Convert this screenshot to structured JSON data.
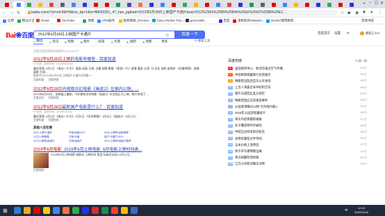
{
  "browser": {
    "tabs": [
      {
        "color": "#e10601"
      },
      {
        "color": "#4285f4"
      },
      {
        "color": "#34a853"
      },
      {
        "color": "#fbbc05"
      },
      {
        "color": "#ea4335"
      },
      {
        "color": "#5f6368"
      },
      {
        "color": "#4285f4"
      },
      {
        "color": "#2932e1"
      },
      {
        "color": "#e10601"
      },
      {
        "color": "#e10601"
      },
      {
        "color": "#0f9d58"
      },
      {
        "color": "#673ab7"
      },
      {
        "color": "#ff7043"
      },
      {
        "color": "#2932e1"
      },
      {
        "color": "#4285f4"
      },
      {
        "color": "#e10601"
      },
      {
        "color": "#34a853"
      },
      {
        "color": "#f4b400"
      },
      {
        "color": "#e10601"
      },
      {
        "color": "#4285f4"
      },
      {
        "color": "#ea4335"
      },
      {
        "color": "#2932e1"
      },
      {
        "color": "#0f9d58"
      },
      {
        "color": "#5f6368"
      },
      {
        "color": "#e10601"
      },
      {
        "color": "#4285f4"
      },
      {
        "color": "#fbbc05"
      },
      {
        "color": "#e10601"
      },
      {
        "color": "#2932e1"
      },
      {
        "color": "#34a853"
      },
      {
        "color": "#e10601"
      },
      {
        "color": "#2932e1"
      }
    ],
    "new_tab": "+",
    "url": "baidu.com/s?ie=utf-8&f=8&rsv_bp=1&tn=88093251_47_hao_pg&wd=2012年6月28日上映国产卡通片&oq=2012%25E5%25B9%25B46%25E6%259C%2588%25E2...",
    "bookmarks": [
      {
        "label": "应用",
        "color": "#4285f4"
      },
      {
        "label": "网址大全",
        "color": "#34a853"
      },
      {
        "label": "Gmail",
        "color": "#ea4335"
      },
      {
        "label": "YouTube",
        "color": "#ff0000"
      },
      {
        "label": "地图",
        "color": "#34a853"
      },
      {
        "label": "VPN服务",
        "color": "#4285f4"
      },
      {
        "label": "极客搜搜_Chrome...",
        "color": "#fbbc05"
      },
      {
        "label": "Cisco Packet Trac...",
        "color": "#1ba0d7"
      },
      {
        "label": "gnmxxl/all...",
        "color": "#333333"
      },
      {
        "label": "百度",
        "color": "#2932e1"
      },
      {
        "label": "虚拟机的VMware...",
        "color": "#e10601"
      },
      {
        "label": "Docker使用教程...",
        "color": "#2496ed"
      }
    ],
    "bookmarks_more": "其他书签"
  },
  "header": {
    "query": "2012年6月28日上映国产卡通片",
    "search_button": "百度一下",
    "right_links": [
      "百度首页",
      "设置"
    ],
    "username": "最爱正义00"
  },
  "search_tabs": [
    {
      "label": "网页",
      "icon": "◎"
    },
    {
      "label": "资讯",
      "icon": "▤"
    },
    {
      "label": "视频",
      "icon": "▶"
    },
    {
      "label": "图片",
      "icon": "▣"
    },
    {
      "label": "知道",
      "icon": "?"
    },
    {
      "label": "文库",
      "icon": "▥"
    },
    {
      "label": "贴吧",
      "icon": "◧"
    },
    {
      "label": "地图",
      "icon": "◉"
    },
    {
      "label": "更多",
      "icon": "⋯"
    }
  ],
  "search_tools": "搜索工具",
  "result_count": "百度为您找到相关结果约9,510,000个",
  "results": [
    {
      "title_pre": "2012年6月28日上映",
      "title_post": "的电影有哪些 - 百度知道",
      "meta": "1个回答 - 回答时间：2012年6月28日",
      "abstract": "最佳答案: 6月1日 《青出一片天》 喜剧 动画 主演: 白蕾 胡静 黄璐 《家庭一片》爱情 喜剧 主演: 冯 远征 张熙 梁锦祥 《旧情绵绵》 爱情 喜剧 主演...",
      "url": "更多关于2012年6月28日上映国产卡通片的问题>>",
      "foot": [
        "百度知道",
        "百度快照"
      ]
    },
    {
      "title_pre": "2012年6月28日",
      "title_post": "内地观众幻电影《画皮2》在国内公映。...",
      "meta": "",
      "abstract": "2012年6月28日，由陈嘉上编剧、乌尔善执导的电影《画皮2》在全国正式上映。影片讲述了...",
      "url": "",
      "foot": [
        "百度百科",
        "百度快照"
      ]
    },
    {
      "title_pre": "2012年6月28日",
      "title_post": "最新国产电影是什么？- 百度知道",
      "meta": "1个回答 - 回答时间：2012年7月1日",
      "abstract": "最佳答案: 6月1日 《青出一片天》 6月5日 《功夫熊猫》 6月8日 《画皮2》 6月12日 ...",
      "url": "",
      "foot": [
        "百度知道",
        "百度快照"
      ]
    },
    {
      "title_pre": "2019年6月电影",
      "title_post": "_2019年6月上映电影_6月电影上映时间表...",
      "meta": "",
      "abstract": "2019年6月上映电影 电影名 上映时间 类型 玩具总动员4 6月21日...",
      "url": "",
      "foot": [
        "百度快照"
      ]
    }
  ],
  "related": {
    "title": "其他人还在搜",
    "items": [
      "2012上映卡通片",
      "中国动画2012",
      "2020上映的动画电影",
      "12月上映电影",
      "古装卡通",
      "国产卡通片2012",
      "12月上映的动画片",
      "古装动画片",
      "2012上映的动画片推荐"
    ]
  },
  "hot": {
    "title": "百度热榜",
    "refresh": "换一换",
    "items": [
      {
        "rank": "1",
        "text": "美国疾控中心：新冠可通过空气传播",
        "num": "493万",
        "color": "#fe2d46"
      },
      {
        "rank": "2",
        "text": "中国邮政储蓄银行女装展示",
        "num": "465万",
        "color": "#f60"
      },
      {
        "rank": "3",
        "text": "特朗普出院后首次公开讲话",
        "num": "450万",
        "color": "#faa90e"
      },
      {
        "rank": "4",
        "text": "上百人清晨百米冲刺的告白",
        "num": "434万",
        "color": "#8eb9f5"
      },
      {
        "rank": "5",
        "text": "我外交部回应美方指控",
        "num": "419万",
        "color": "#8eb9f5"
      },
      {
        "rank": "6",
        "text": "特朗普回应白宫感染事件",
        "num": "405万",
        "color": "#8eb9f5"
      },
      {
        "rank": "7",
        "text": "31省新增确诊13例 均为境外输入",
        "num": "394万",
        "color": "#8eb9f5"
      },
      {
        "rank": "8",
        "text": "2019年公园游客量统计",
        "num": "382万",
        "color": "#8eb9f5"
      },
      {
        "rank": "9",
        "text": "青岛市疫情最新通报",
        "num": "371万",
        "color": "#8eb9f5"
      },
      {
        "rank": "10",
        "text": "女子撒谎称怀孕被拘",
        "num": "363万",
        "color": "#8eb9f5"
      },
      {
        "rank": "11",
        "text": "中国自主研发新冠疫苗",
        "num": "354万",
        "color": "#8eb9f5"
      },
      {
        "rank": "12",
        "text": "关晓彤鹿晗分手传闻",
        "num": "340万",
        "color": "#8eb9f5"
      },
      {
        "rank": "13",
        "text": "玉米价格上涨原因",
        "num": "327万",
        "color": "#8eb9f5"
      },
      {
        "rank": "14",
        "text": "男子开车撞倒路边摊",
        "num": "314万",
        "color": "#8eb9f5"
      },
      {
        "rank": "15",
        "text": "青岛核酸检测进展",
        "num": "302万",
        "color": "#8eb9f5"
      },
      {
        "rank": "16",
        "text": "江苏公布新冠确诊详情",
        "num": "294万",
        "color": "#8eb9f5"
      }
    ]
  },
  "taskbar": {
    "start": "⊞",
    "apps": [
      "#2d7dd2",
      "#e8ac23",
      "#e10601",
      "#ffcc00",
      "#4285f4",
      "#ff7043",
      "#34a853",
      "#2932e1",
      "#cc3333",
      "#1f8b4c",
      "#ea4335",
      "#fbbc05",
      "#3f6bbf"
    ],
    "lang": "中",
    "time": "12:19",
    "date": "2020/10/16"
  }
}
